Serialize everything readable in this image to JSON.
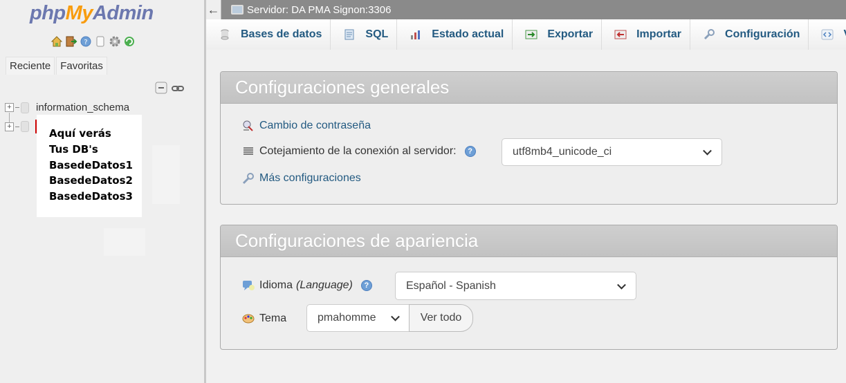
{
  "sidebar": {
    "logo": {
      "php": "php",
      "my": "My",
      "admin": "Admin"
    },
    "quick_icons": [
      "home-icon",
      "exit-icon",
      "help-icon",
      "docs-icon",
      "settings-icon",
      "reload-icon"
    ],
    "tabs": [
      "Reciente",
      "Favoritas"
    ],
    "tree": [
      {
        "name": "information_schema"
      }
    ],
    "annotation_lines": [
      "Aquí verás",
      "Tus DB's",
      "BasedeDatos1",
      "BasedeDatos2",
      "BasedeDatos3"
    ]
  },
  "server_bar": {
    "collapse": "←",
    "label": "Servidor: DA PMA Signon:3306"
  },
  "menu": [
    {
      "label": "Bases de datos",
      "icon": "database-icon"
    },
    {
      "label": "SQL",
      "icon": "sql-icon"
    },
    {
      "label": "Estado actual",
      "icon": "status-icon"
    },
    {
      "label": "Exportar",
      "icon": "export-icon"
    },
    {
      "label": "Importar",
      "icon": "import-icon"
    },
    {
      "label": "Configuración",
      "icon": "wrench-icon"
    },
    {
      "label": "Va",
      "icon": "variables-icon"
    }
  ],
  "general": {
    "title": "Configuraciones generales",
    "change_password": "Cambio de contraseña",
    "collation_label": "Cotejamiento de la conexión al servidor:",
    "collation_value": "utf8mb4_unicode_ci",
    "more_settings": "Más configuraciones"
  },
  "appearance": {
    "title": "Configuraciones de apariencia",
    "language_label": "Idioma",
    "language_hint": "(Language)",
    "language_value": "Español - Spanish",
    "theme_label": "Tema",
    "theme_value": "pmahomme",
    "view_all": "Ver todo"
  }
}
